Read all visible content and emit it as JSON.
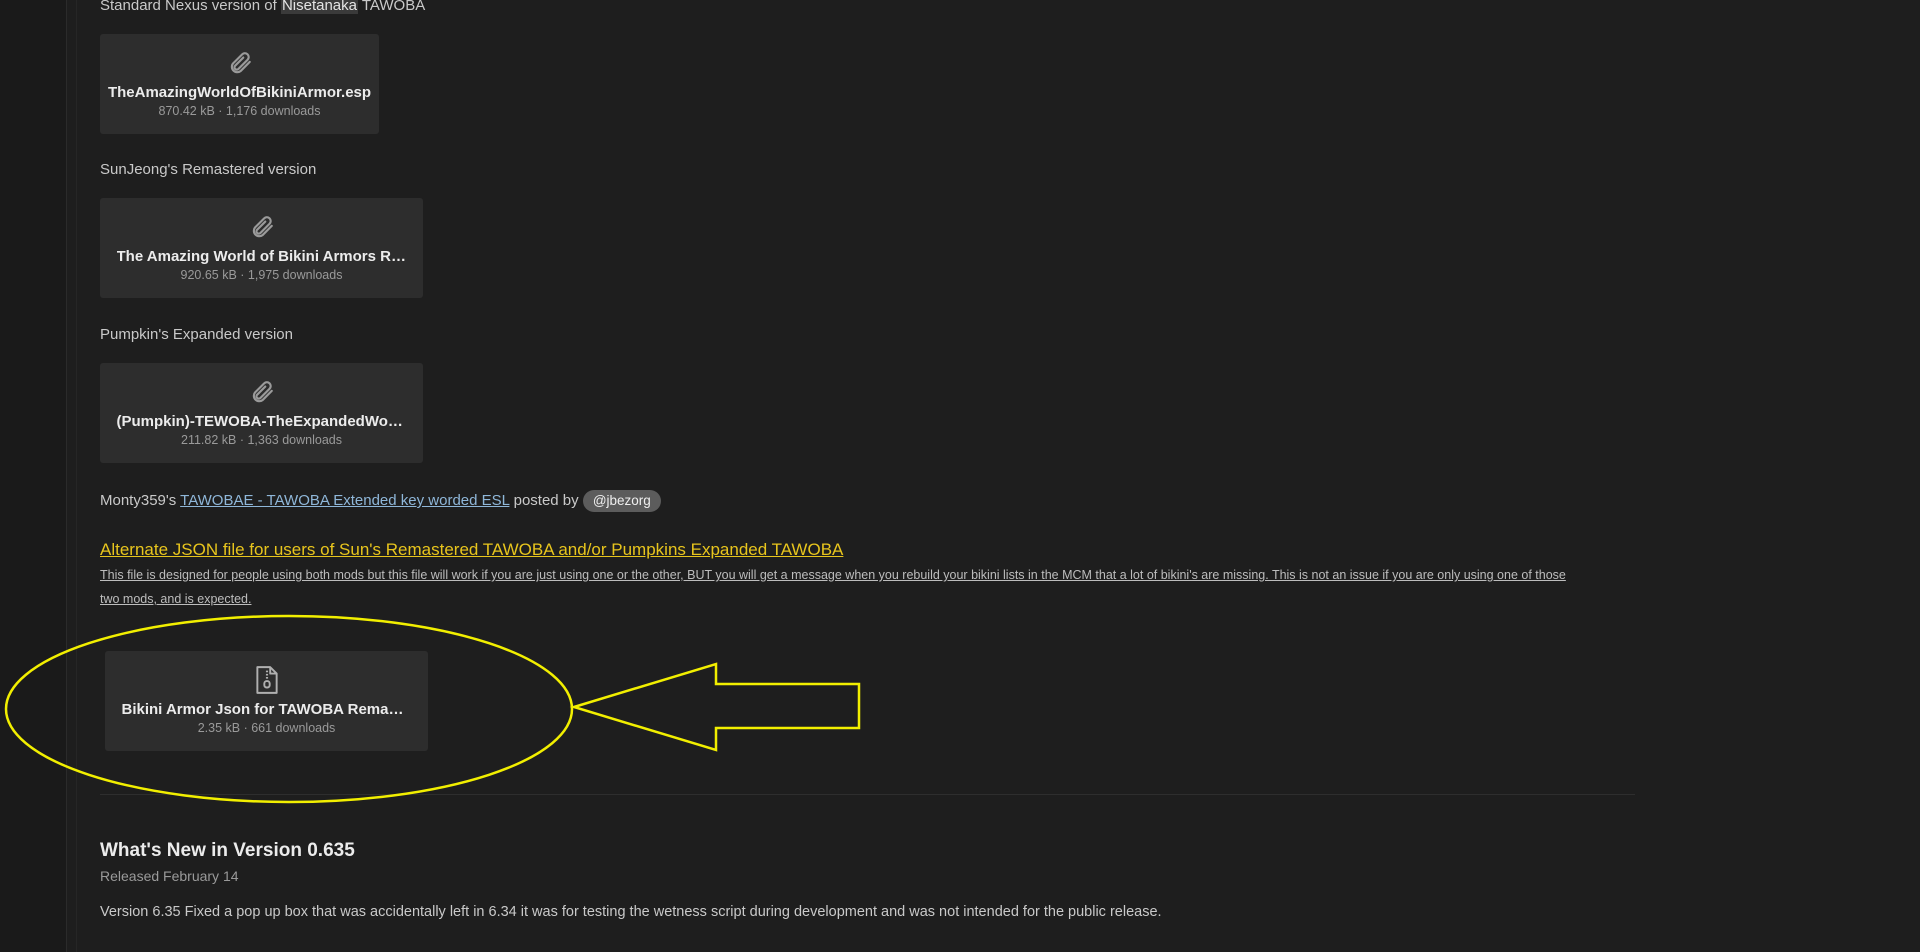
{
  "sections": {
    "standard": {
      "label_pre": "Standard Nexus version of ",
      "label_highlight": "Nisetanaka",
      "label_post": " TAWOBA",
      "file": {
        "name": "TheAmazingWorldOfBikiniArmor.esp",
        "meta": "870.42 kB · 1,176 downloads",
        "icon": "paperclip-icon"
      }
    },
    "sunjeong": {
      "label": "SunJeong's Remastered version",
      "file": {
        "name": "The Amazing World of Bikini Armors RE...",
        "meta": "920.65 kB · 1,975 downloads",
        "icon": "paperclip-icon"
      }
    },
    "pumpkin": {
      "label": "Pumpkin's Expanded version",
      "file": {
        "name": "(Pumpkin)-TEWOBA-TheExpandedWorld...",
        "meta": "211.82 kB · 1,363 downloads",
        "icon": "paperclip-icon"
      }
    }
  },
  "monty": {
    "pre": "Monty359's ",
    "link": "TAWOBAE - TAWOBA Extended key worded ESL",
    "mid": " posted by ",
    "user": "@jbezorg"
  },
  "alternate": {
    "title": "Alternate JSON file for users of Sun's Remastered TAWOBA and/or Pumpkins Expanded TAWOBA",
    "desc_line1": "This file is designed for people using both mods but this file will work if you are just using one or the other, BUT you will get a message when you rebuild your bikini lists in the MCM that a lot of bikini's are missing. This is not an issue if you are only using one of those",
    "desc_line2": "two mods, and is expected.",
    "file": {
      "name": "Bikini Armor Json for TAWOBA Remaster...",
      "meta": "2.35 kB · 661 downloads",
      "icon": "zip-file-icon"
    }
  },
  "annotation": {
    "color": "#f2ef00"
  },
  "whats_new": {
    "title": "What's New in Version 0.635",
    "released": "Released February 14",
    "body": "Version 6.35 Fixed a pop up box that was accidentally left in 6.34 it was for testing the wetness script during development and was not intended for the public release."
  }
}
